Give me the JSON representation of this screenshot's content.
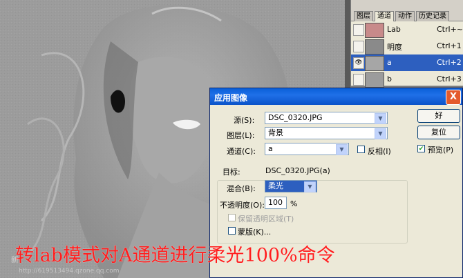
{
  "channels_panel": {
    "tabs": [
      "图层",
      "通道",
      "动作",
      "历史记录"
    ],
    "active_tab": "通道",
    "rows": [
      {
        "name": "Lab",
        "shortcut": "Ctrl+~",
        "visible": false,
        "selected": false
      },
      {
        "name": "明度",
        "shortcut": "Ctrl+1",
        "visible": false,
        "selected": false
      },
      {
        "name": "a",
        "shortcut": "Ctrl+2",
        "visible": true,
        "selected": true
      },
      {
        "name": "b",
        "shortcut": "Ctrl+3",
        "visible": false,
        "selected": false
      }
    ]
  },
  "dialog": {
    "title": "应用图像",
    "close": "X",
    "source_label": "源(S):",
    "source_value": "DSC_0320.JPG",
    "layer_label": "图层(L):",
    "layer_value": "背景",
    "channel_label": "通道(C):",
    "channel_value": "a",
    "invert_label": "反相(I)",
    "target_label": "目标:",
    "target_value": "DSC_0320.JPG(a)",
    "blend_label": "混合(B):",
    "blend_value": "柔光",
    "opacity_label": "不透明度(O):",
    "opacity_value": "100",
    "opacity_unit": "%",
    "preserve_label": "保留透明区域(T)",
    "mask_label": "蒙版(K)...",
    "ok_label": "好",
    "reset_label": "复位",
    "preview_label": "预览(P)",
    "preview_checked": true,
    "invert_checked": false,
    "mask_checked": false
  },
  "caption": "转lab模式对A通道进行柔光100%命令",
  "watermark": {
    "logo": "新",
    "url": "http://619513494.qzone.qq.com"
  },
  "colors": {
    "caption": "#ff1e1e",
    "titlebar": "#0a5fd8",
    "selection": "#2d5fbf"
  }
}
